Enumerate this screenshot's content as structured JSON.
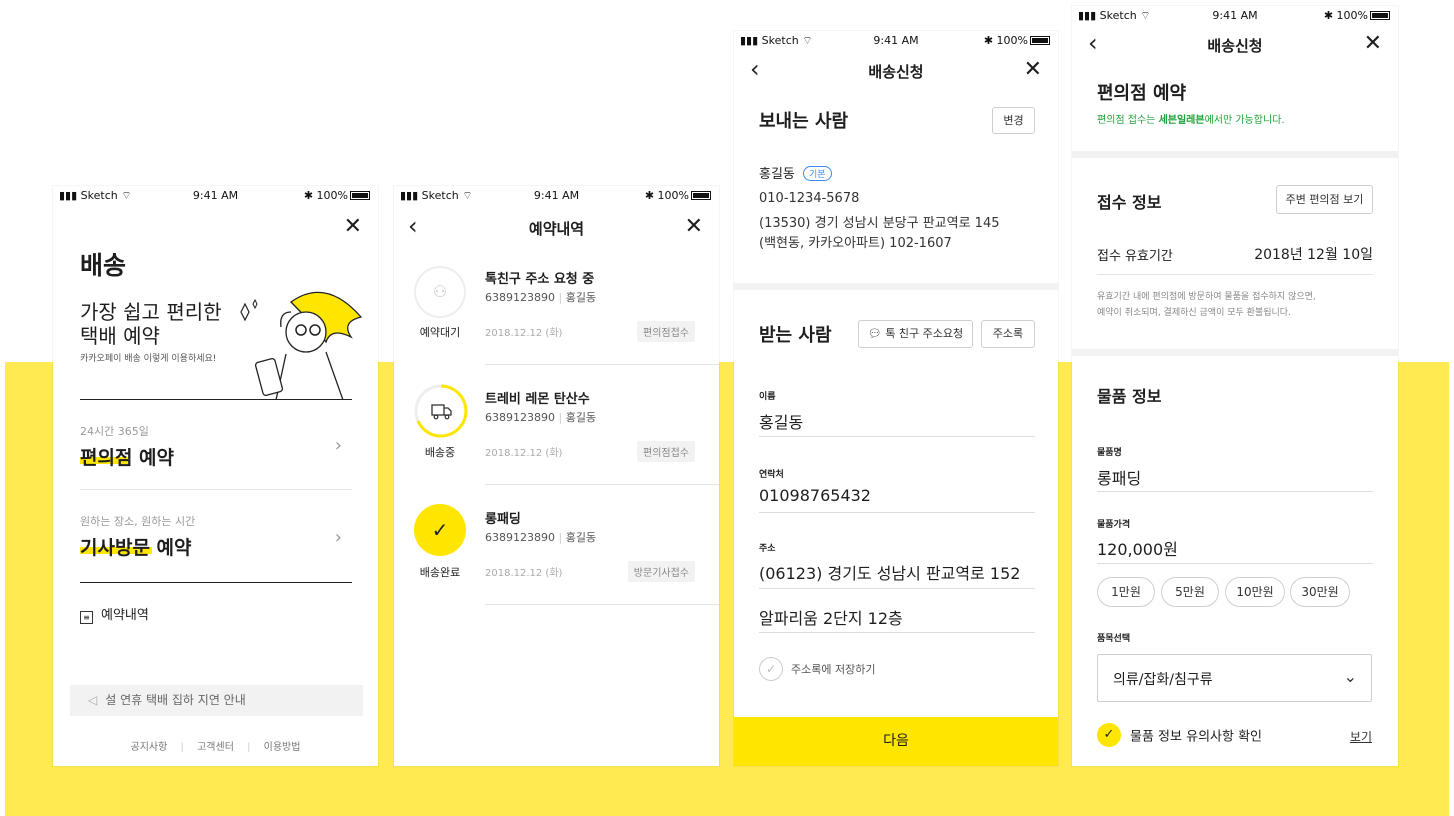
{
  "status_bar": {
    "carrier": "Sketch",
    "time": "9:41 AM",
    "battery": "100%"
  },
  "screen1": {
    "title": "배송",
    "headline_line1": "가장 쉽고 편리한",
    "headline_line2": "택배 예약",
    "subtitle": "카카오페이 배송 이렇게 이용하세요!",
    "option1": {
      "caption": "24시간 365일",
      "title": "편의점 예약"
    },
    "option2": {
      "caption": "원하는 장소, 원하는 시간",
      "title": "기사방문 예약"
    },
    "history_label": "예약내역",
    "notice": "설 연휴 택배 집하 지연 안내",
    "footer_links": [
      "공지사항",
      "고객센터",
      "이용방법"
    ]
  },
  "screen2": {
    "nav_title": "예약내역",
    "items": [
      {
        "status": "예약대기",
        "name": "톡친구 주소 요청 중",
        "tracking": "6389123890",
        "person": "홍길동",
        "date": "2018.12.12 (화)",
        "tag": "편의점접수"
      },
      {
        "status": "배송중",
        "name": "트레비 레몬 탄산수",
        "tracking": "6389123890",
        "person": "홍길동",
        "date": "2018.12.12 (화)",
        "tag": "편의점접수"
      },
      {
        "status": "배송완료",
        "name": "롱패딩",
        "tracking": "6389123890",
        "person": "홍길동",
        "date": "2018.12.12 (화)",
        "tag": "방문기사접수"
      }
    ]
  },
  "screen3": {
    "nav_title": "배송신청",
    "sender_title": "보내는 사람",
    "change_button": "변경",
    "sender_name": "홍길동",
    "sender_badge": "기본",
    "sender_phone": "010-1234-5678",
    "sender_addr1": "(13530) 경기 성남시 분당구 판교역로 145",
    "sender_addr2": "(백현동, 카카오아파트) 102-1607",
    "receiver_title": "받는 사람",
    "talk_friend_button": "톡 친구 주소요청",
    "address_book_button": "주소록",
    "name_label": "이름",
    "name_value": "홍길동",
    "phone_label": "연락처",
    "phone_value": "01098765432",
    "addr_label": "주소",
    "addr_value": "(06123) 경기도 성남시 판교역로 152",
    "addr_detail": "알파리움 2단지 12층",
    "save_label": "주소록에 저장하기",
    "next_button": "다음"
  },
  "screen4": {
    "nav_title": "배송신청",
    "title": "편의점 예약",
    "notice_prefix": "편의점 접수는 ",
    "notice_bold": "세븐일레븐",
    "notice_suffix": "에서만 가능합니다.",
    "receipt_title": "접수 정보",
    "nearby_button": "주변 편의점 보기",
    "validity_label": "접수 유효기간",
    "validity_value": "2018년 12월 10일",
    "validity_note1": "유효기간 내에 편의점에 방문하여 물품을 접수하지 않으면,",
    "validity_note2": "예약이 취소되며, 결제하신 금액이 모두 환불됩니다.",
    "item_title": "물품 정보",
    "item_name_label": "물품명",
    "item_name_value": "롱패딩",
    "item_price_label": "물품가격",
    "item_price_value": "120,000원",
    "price_chips": [
      "1만원",
      "5만원",
      "10만원",
      "30만원"
    ],
    "category_label": "품목선택",
    "category_value": "의류/잡화/침구류",
    "confirm_label": "물품 정보 유의사항 확인",
    "view_link": "보기"
  },
  "colors": {
    "accent_yellow": "#ffe600",
    "background_yellow": "#ffea52",
    "green": "#22a33a",
    "blue_badge": "#3a8cf0"
  }
}
